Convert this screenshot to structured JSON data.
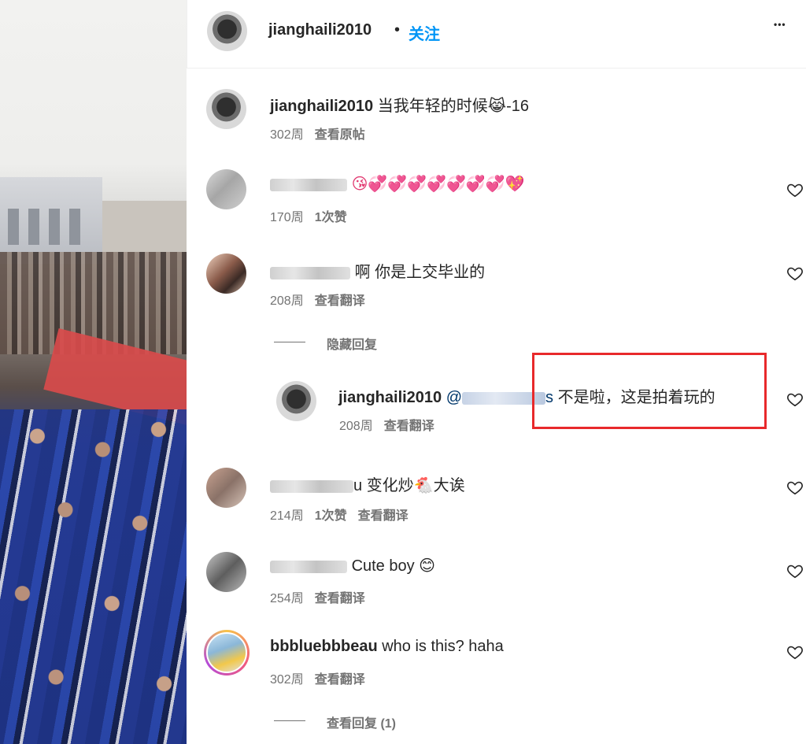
{
  "header": {
    "username": "jianghaili2010",
    "separator": "•",
    "follow_label": "关注",
    "more_label": "•••"
  },
  "caption": {
    "username": "jianghaili2010",
    "text": "当我年轻的时候😹-16",
    "age": "302周",
    "action": "查看原帖"
  },
  "comments": [
    {
      "text": "😘💞💞💞💞💞💞💞💖",
      "age": "170周",
      "likes": "1次赞"
    },
    {
      "text": "啊 你是上交毕业的",
      "age": "208周",
      "action": "查看翻译",
      "hide_replies": "隐藏回复"
    },
    {
      "reply_username": "jianghaili2010",
      "mention": "@",
      "mention_tail": "s",
      "text": "不是啦，这是拍着玩的",
      "age": "208周",
      "action": "查看翻译"
    },
    {
      "name_tail": "u",
      "text": "变化炒🐔大诶",
      "age": "214周",
      "likes": "1次赞",
      "action": "查看翻译"
    },
    {
      "text": "Cute boy 😊",
      "age": "254周",
      "action": "查看翻译"
    },
    {
      "username": "bbbluebbbeau",
      "text": "who is this? haha",
      "age": "302周",
      "action": "查看翻译",
      "view_replies": "查看回复 (1)"
    }
  ],
  "colors": {
    "follow": "#0095f6",
    "highlight_box": "#e8292b",
    "meta": "#737373",
    "mention": "#00376b"
  }
}
